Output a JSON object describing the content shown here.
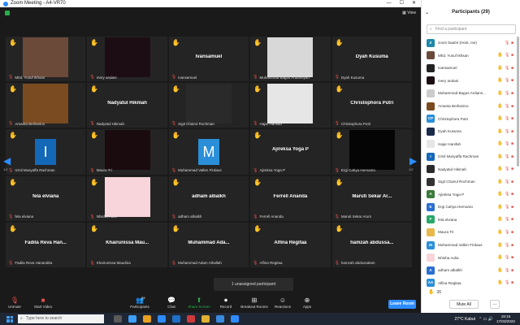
{
  "window": {
    "title": "Zoom Meeting - A4-VR70",
    "controls": [
      "—",
      "☐",
      "✕"
    ]
  },
  "meeting": {
    "view_label": "View",
    "pages": {
      "left": "1/2",
      "right": "1/2"
    },
    "tiles": [
      {
        "big": "",
        "tag": "Mhd. Yusuf Ikhsan",
        "hand": true,
        "video": "#6b4a3a"
      },
      {
        "big": "",
        "tag": "mery andani",
        "hand": true,
        "video": "#1c0d14"
      },
      {
        "big": "Ivansamuel",
        "tag": "Ivansamuel",
        "hand": true,
        "video": ""
      },
      {
        "big": "",
        "tag": "Muhammad Bagus Ardiansyah",
        "hand": true,
        "video": "#d8d8d8"
      },
      {
        "big": "Dyah Kusuma",
        "tag": "Dyah Kusuma",
        "hand": true,
        "video": ""
      },
      {
        "big": "",
        "tag": "Amanta Berlianino",
        "hand": true,
        "video": "#7a4a20"
      },
      {
        "big": "Nadyatul Hikmah",
        "tag": "Nadyatul Hikmah",
        "hand": true,
        "video": ""
      },
      {
        "big": "",
        "tag": "Sigit Chairul Rochman",
        "hand": true,
        "video": "#2a2a2a"
      },
      {
        "big": "",
        "tag": "Hajar Hanifah",
        "hand": true,
        "video": "#e6e6e6"
      },
      {
        "big": "Christophora Putri",
        "tag": "Christophora Putri",
        "hand": true,
        "video": ""
      },
      {
        "big": "",
        "tag": "Izmil Musyaffa Rachman",
        "hand": true,
        "video": "",
        "avatar": "I",
        "avatar_color": "#1468b8"
      },
      {
        "big": "",
        "tag": "Maura Tri",
        "hand": true,
        "video": "#1a0b0e"
      },
      {
        "big": "",
        "tag": "Muhammad Vallen Firdaus",
        "hand": true,
        "video": "",
        "avatar": "M",
        "avatar_color": "#2a8fd8"
      },
      {
        "big": "Ajireksa Yoga P",
        "tag": "Ajireksa Yoga P",
        "hand": true,
        "video": ""
      },
      {
        "big": "",
        "tag": "Ergi Cahya Hernanto",
        "hand": true,
        "video": "#050505"
      },
      {
        "big": "fela elviana",
        "tag": "fela elviana",
        "hand": true,
        "video": ""
      },
      {
        "big": "",
        "tag": "Nhisha Aulia",
        "hand": true,
        "video": "#f7d5da"
      },
      {
        "big": "adham albalkh",
        "tag": "adham albalkh",
        "hand": true,
        "video": ""
      },
      {
        "big": "Ferrell Ananda",
        "tag": "Ferrell Ananda",
        "hand": true,
        "video": ""
      },
      {
        "big": "Maruti Sekar Ar...",
        "tag": "Maruti Sekar Arum",
        "hand": true,
        "video": ""
      },
      {
        "big": "Fadila Reva Han...",
        "tag": "Fadila Reva Hanandita",
        "hand": true,
        "video": ""
      },
      {
        "big": "Khairunissa Mau...",
        "tag": "Khairunissa Maudina",
        "hand": true,
        "video": ""
      },
      {
        "big": "Muhammad Ada...",
        "tag": "Muhammad Adam Athallah",
        "hand": true,
        "video": ""
      },
      {
        "big": "Alfina Regitaa",
        "tag": "Alfina Regitaa",
        "hand": true,
        "video": ""
      },
      {
        "big": "hamzah abdussa...",
        "tag": "hamzah abdussalam",
        "hand": true,
        "video": ""
      }
    ],
    "toast": "1 unassigned participant"
  },
  "toolbar": {
    "unmute": "Unmute",
    "start_video": "Start Video",
    "participants": "Participants",
    "participants_count": "29",
    "chat": "Chat",
    "share_screen": "Share Screen",
    "record": "Record",
    "breakout": "Breakout Rooms",
    "reactions": "Reactions",
    "apps": "Apps",
    "leave": "Leave Room"
  },
  "panel": {
    "title": "Participants (29)",
    "search_placeholder": "Find a participant",
    "participants": [
      {
        "name": "zoom baa04 (Host, me)",
        "initial": "Z",
        "color": "#1e88a8",
        "hand": false
      },
      {
        "name": "Mhd. Yusuf Ikhsan",
        "initial": "",
        "color": "#6b4a3a",
        "hand": true
      },
      {
        "name": "Ivansamuel",
        "initial": "",
        "color": "#222222",
        "hand": true
      },
      {
        "name": "mery andani",
        "initial": "",
        "color": "#1c0d14",
        "hand": true
      },
      {
        "name": "Muhammad Bagus Ardians...",
        "initial": "",
        "color": "#cccccc",
        "hand": true
      },
      {
        "name": "Amanta Berlianino",
        "initial": "",
        "color": "#7a4a20",
        "hand": true
      },
      {
        "name": "Christophora Putri",
        "initial": "CP",
        "color": "#2a8fd8",
        "hand": true
      },
      {
        "name": "Dyah Kusuma",
        "initial": "",
        "color": "#1a2a4a",
        "hand": true
      },
      {
        "name": "Hajar Hanifah",
        "initial": "",
        "color": "#e6e6e6",
        "hand": true
      },
      {
        "name": "Izmil Musyaffa Rachman",
        "initial": "I",
        "color": "#1468b8",
        "hand": true
      },
      {
        "name": "Nadyatul Hikmah",
        "initial": "",
        "color": "#2a2a2a",
        "hand": true
      },
      {
        "name": "Sigit Chairul Rochman",
        "initial": "",
        "color": "#333333",
        "hand": true
      },
      {
        "name": "Ajireksa Yoga P",
        "initial": "A",
        "color": "#3a7a3a",
        "hand": true
      },
      {
        "name": "Ergi Cahya Hernanto",
        "initial": "E",
        "color": "#2a6fd0",
        "hand": true
      },
      {
        "name": "fela elviana",
        "initial": "F",
        "color": "#28a868",
        "hand": true
      },
      {
        "name": "Maura Tri",
        "initial": "",
        "color": "#e8b84a",
        "hand": true
      },
      {
        "name": "Muhammad Vallen Firdaus",
        "initial": "M",
        "color": "#2a8fd8",
        "hand": true
      },
      {
        "name": "Nhisha Aulia",
        "initial": "",
        "color": "#f7d5da",
        "hand": true
      },
      {
        "name": "adham albalkh",
        "initial": "A",
        "color": "#2a6fd0",
        "hand": true
      },
      {
        "name": "Alfina Regitaa",
        "initial": "AA",
        "color": "#2a8fd8",
        "hand": true
      }
    ],
    "hand_count": "26",
    "mute_all": "Mute All",
    "more": "..."
  },
  "taskbar": {
    "search": "Type here to search",
    "weather": "27°C  Kabut",
    "time": "19:15",
    "date": "17/03/2022",
    "apps_colors": [
      "#5a5a5a",
      "#3ea0ff",
      "#e8a020",
      "#2d8cff",
      "#1e70c8",
      "#d03a3a",
      "#e0b030",
      "#3a8ae0",
      "#2d8cff"
    ]
  }
}
